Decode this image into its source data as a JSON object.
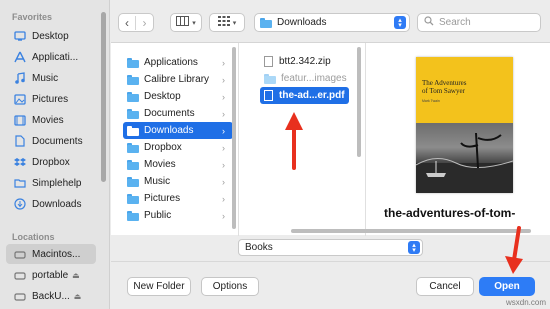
{
  "sidebar": {
    "favorites_heading": "Favorites",
    "favorites": [
      {
        "label": "Desktop",
        "icon": "desktop-icon"
      },
      {
        "label": "Applicati...",
        "icon": "applications-icon"
      },
      {
        "label": "Music",
        "icon": "music-icon"
      },
      {
        "label": "Pictures",
        "icon": "pictures-icon"
      },
      {
        "label": "Movies",
        "icon": "movies-icon"
      },
      {
        "label": "Documents",
        "icon": "documents-icon"
      },
      {
        "label": "Dropbox",
        "icon": "dropbox-icon"
      },
      {
        "label": "Simplehelp",
        "icon": "folder-icon"
      },
      {
        "label": "Downloads",
        "icon": "downloads-icon"
      }
    ],
    "locations_heading": "Locations",
    "locations": [
      {
        "label": "Macintos...",
        "icon": "disk-icon",
        "selected": true
      },
      {
        "label": "portable",
        "icon": "disk-icon",
        "eject": true
      },
      {
        "label": "BackU...",
        "icon": "disk-icon",
        "eject": true
      }
    ]
  },
  "toolbar": {
    "path_label": "Downloads",
    "search_placeholder": "Search"
  },
  "columns": {
    "col1": [
      {
        "label": "Applications"
      },
      {
        "label": "Calibre Library"
      },
      {
        "label": "Desktop"
      },
      {
        "label": "Documents"
      },
      {
        "label": "Downloads",
        "selected": true
      },
      {
        "label": "Dropbox"
      },
      {
        "label": "Movies"
      },
      {
        "label": "Music"
      },
      {
        "label": "Pictures"
      },
      {
        "label": "Public"
      }
    ],
    "col2": [
      {
        "label": "btt2.342.zip",
        "type": "file"
      },
      {
        "label": "featur...images",
        "type": "folder",
        "dim": true
      },
      {
        "label": "the-ad...er.pdf",
        "type": "file",
        "selected": true
      }
    ]
  },
  "preview": {
    "book_title_line1": "The Adventures",
    "book_title_line2": "of Tom Sawyer",
    "book_author": "Mark Twain",
    "filename": "the-adventures-of-tom-"
  },
  "format": {
    "selected": "Books"
  },
  "buttons": {
    "new_folder": "New Folder",
    "options": "Options",
    "cancel": "Cancel",
    "open": "Open"
  },
  "colors": {
    "accent": "#1f6fe6",
    "arrow": "#e8301e",
    "book": "#f3c21c"
  },
  "watermark": "wsxdn.com"
}
